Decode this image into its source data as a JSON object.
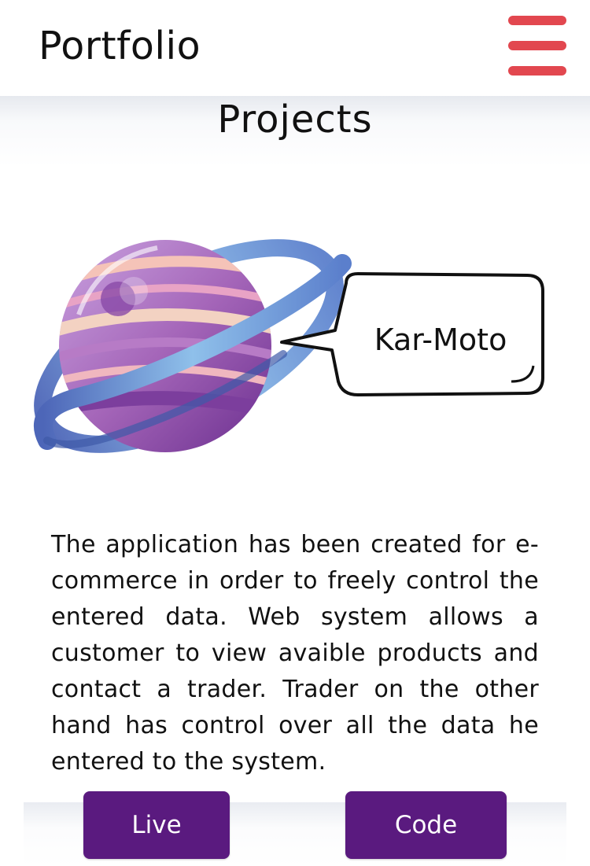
{
  "header": {
    "brand": "Portfolio",
    "menu_icon": "hamburger-menu-icon",
    "menu_color": "#e2474f"
  },
  "section": {
    "title": "Projects"
  },
  "project": {
    "name": "Kar-Moto",
    "illustration": "planet-icon",
    "description": "The application has been created for e-commerce in order to freely control the entered data. Web system allows a customer to view avaible products and contact a trader. Trader on the other hand has control over all the data he entered to the system.",
    "buttons": {
      "live_label": "Live",
      "code_label": "Code",
      "color": "#5a1a7f"
    }
  }
}
